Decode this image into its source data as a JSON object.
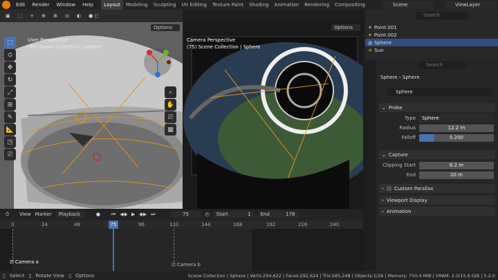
{
  "menu": [
    "Edit",
    "Render",
    "Window",
    "Help"
  ],
  "workspaces": [
    {
      "label": "Layout",
      "active": true
    },
    {
      "label": "Modeling"
    },
    {
      "label": "Sculpting"
    },
    {
      "label": "UV Editing"
    },
    {
      "label": "Texture Paint"
    },
    {
      "label": "Shading"
    },
    {
      "label": "Animation"
    },
    {
      "label": "Rendering"
    },
    {
      "label": "Compositing"
    }
  ],
  "scene": {
    "label": "Scene",
    "viewlayer": "ViewLayer"
  },
  "left_view": {
    "title": "User Perspective",
    "collection": "(75) Scene Collection | Sphere",
    "options": "Options"
  },
  "camera_view": {
    "title": "Camera Perspective",
    "collection": "(75) Scene Collection | Sphere",
    "options": "Options"
  },
  "outliner": {
    "search_placeholder": "Search",
    "items": [
      {
        "name": "Point.001"
      },
      {
        "name": "Point.002"
      },
      {
        "name": "Sphere",
        "selected": true
      },
      {
        "name": "Sun"
      }
    ]
  },
  "properties": {
    "search_placeholder": "Search",
    "breadcrumb": [
      "Sphere",
      "Sphere"
    ],
    "data_name": "Sphere",
    "probe": {
      "header": "Probe",
      "type_label": "Type",
      "type_value": "Sphere",
      "radius_label": "Radius",
      "radius_value": "12.2 m",
      "falloff_label": "Falloff",
      "falloff_value": "0.200",
      "falloff_fraction": 0.2
    },
    "capture": {
      "header": "Capture",
      "clip_start_label": "Clipping Start",
      "clip_start_value": "6.2 m",
      "end_label": "End",
      "end_value": "20 m"
    },
    "custom_parallax": "Custom Parallax",
    "viewport_display": "Viewport Display",
    "animation": "Animation"
  },
  "timeline": {
    "menus": [
      "View",
      "Marker",
      "Playback"
    ],
    "current_frame": "75",
    "start_label": "Start",
    "start_value": "1",
    "end_label": "End",
    "end_value": "178",
    "ticks": [
      "0",
      "24",
      "48",
      "75",
      "96",
      "120",
      "144",
      "168",
      "192",
      "216",
      "240"
    ],
    "markers": [
      "Camera a",
      "Camera b"
    ]
  },
  "status": {
    "select": "Select",
    "rotate": "Rotate View",
    "options": "Options",
    "info": "Scene Collection | Sphere | Verts:294,622 | Faces:292,624 | Tris:585,248 | Objects:1/26 | Memory: 750.4 MiB | VRAM: 2.0/15.6 GiB | 5.2.0"
  }
}
